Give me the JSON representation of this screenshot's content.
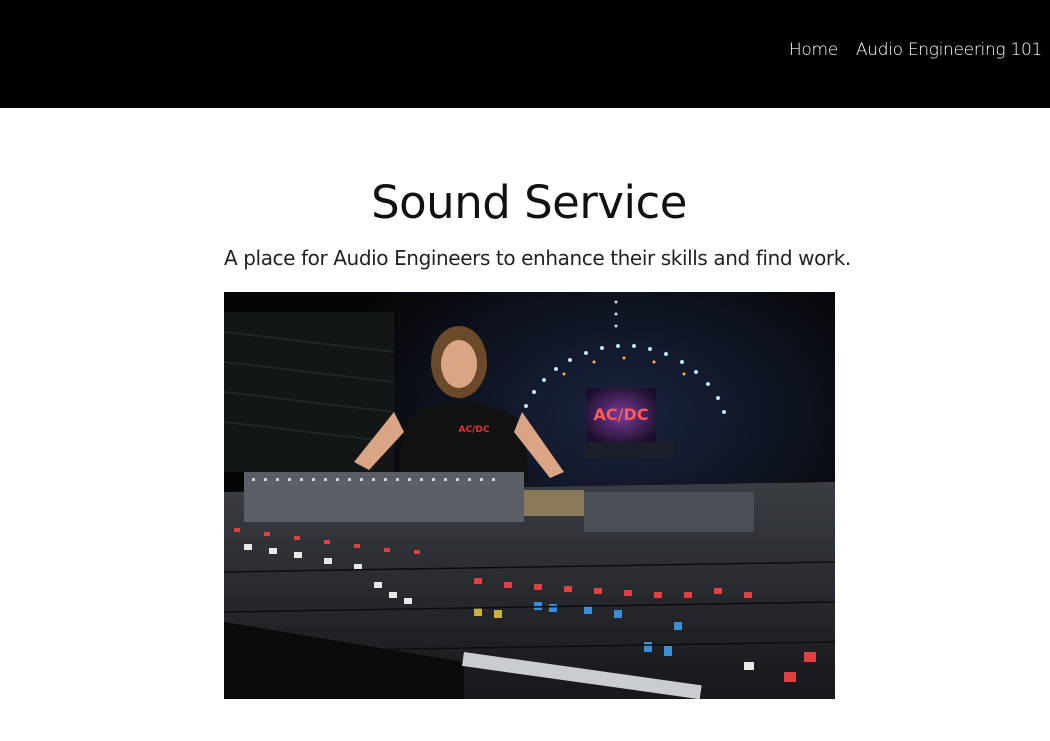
{
  "nav": {
    "items": [
      {
        "label": "Home"
      },
      {
        "label": "Audio Engineering 101"
      }
    ]
  },
  "hero": {
    "title": "Sound Service",
    "tagline": "A place for Audio Engineers to enhance their skills and find work."
  },
  "image": {
    "description_icon": "mixing-console-photo",
    "shirt_logo": "AC/DC",
    "screen_logo": "AC/DC"
  },
  "colors": {
    "header_bg": "#000000",
    "page_bg": "#ffffff",
    "text": "#111111"
  }
}
